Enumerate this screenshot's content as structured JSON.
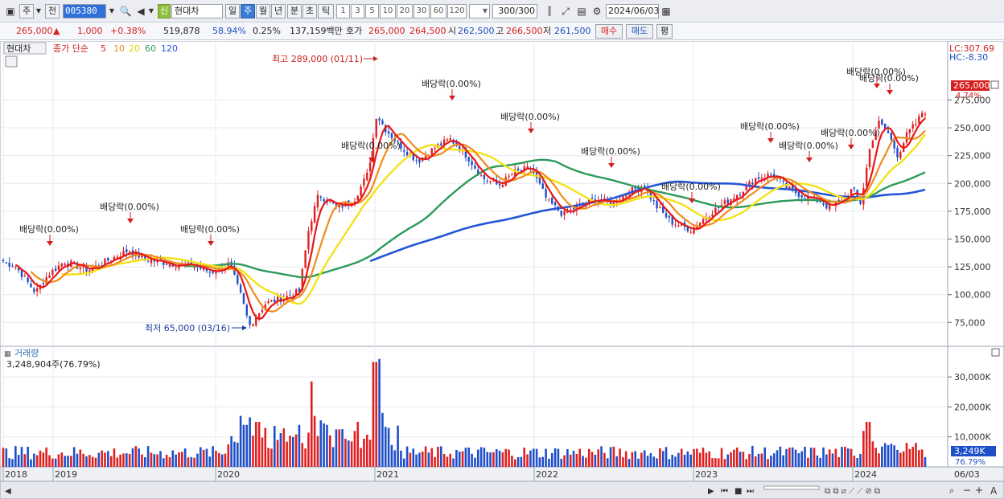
{
  "toolbar": {
    "period_label": "주",
    "prev_label": "전",
    "stock_code": "005380",
    "credit_badge": "신",
    "stock_name": "현대차",
    "intervals": [
      "일",
      "주",
      "월",
      "년",
      "분",
      "초",
      "틱"
    ],
    "active_interval": "주",
    "minute_steps": [
      "1",
      "3",
      "5",
      "10",
      "20",
      "30",
      "60",
      "120"
    ],
    "count": "300",
    "count_total": "/300",
    "date": "2024/06/03"
  },
  "quote": {
    "price": "265,000",
    "change_arrow": "▲",
    "change": "1,000",
    "change_rate": "+0.38%",
    "volume": "519,878",
    "volume_rate": "58.94%",
    "turnover_rate": "0.25%",
    "amount": "137,159백만",
    "bid_label": "호가",
    "bid1": "265,000",
    "bid2": "264,500",
    "open_label": "시",
    "open": "262,500",
    "high_label": "고",
    "high": "266,500",
    "low_label": "저",
    "low": "261,500",
    "buy_label": "매수",
    "sell_label": "매도",
    "eval_label": "평"
  },
  "price_panel": {
    "stock_label": "현대차",
    "ma_title": "종가 단순",
    "ma_periods": [
      "5",
      "10",
      "20",
      "60",
      "120"
    ],
    "lc_label": "LC:307.69",
    "hc_label": "HC:-8.30",
    "current_price_tag": "265,000",
    "current_rate_tag": "4.74%",
    "high_annotation": "최고 289,000 (01/11)",
    "low_annotation": "최저 65,000 (03/16)",
    "dividend_label": "배당락(0.00%)",
    "y_ticks": [
      "275,000",
      "250,000",
      "225,000",
      "200,000",
      "175,000",
      "150,000",
      "125,000",
      "100,000",
      "75,000"
    ]
  },
  "volume_panel": {
    "title": "거래량",
    "value_label": "3,248,904주(76.79%)",
    "y_ticks": [
      "30,000K",
      "20,000K",
      "10,000K"
    ],
    "current_tag": "3,249K",
    "current_rate": "76.79%"
  },
  "x_axis": {
    "labels": [
      "2018",
      "2019",
      "2020",
      "2021",
      "2022",
      "2023",
      "2024",
      "06/03"
    ]
  },
  "colors": {
    "up": "#e02020",
    "down": "#1f4fc8",
    "ma5": "#e81818",
    "ma10": "#f08c1c",
    "ma20": "#f2e21a",
    "ma60": "#2e9a5a",
    "ma120": "#2456d6",
    "accent": "#3a7bd5"
  },
  "chart_data": {
    "type": "line",
    "series": [
      {
        "name": "종가 단순 5",
        "x": [
          "2018",
          "2019",
          "2020",
          "2021",
          "2022",
          "2023",
          "2024",
          "06/03"
        ],
        "values": [
          128000,
          125000,
          120000,
          240000,
          185000,
          180000,
          200000,
          265000
        ]
      },
      {
        "name": "120",
        "x": [
          "2020",
          "2021",
          "2022",
          "2023",
          "2024",
          "06/03"
        ],
        "values": [
          128000,
          155000,
          185000,
          200000,
          188000,
          193000
        ]
      }
    ],
    "volume_last_k": 3249,
    "ylim": [
      55000,
      310000
    ]
  }
}
